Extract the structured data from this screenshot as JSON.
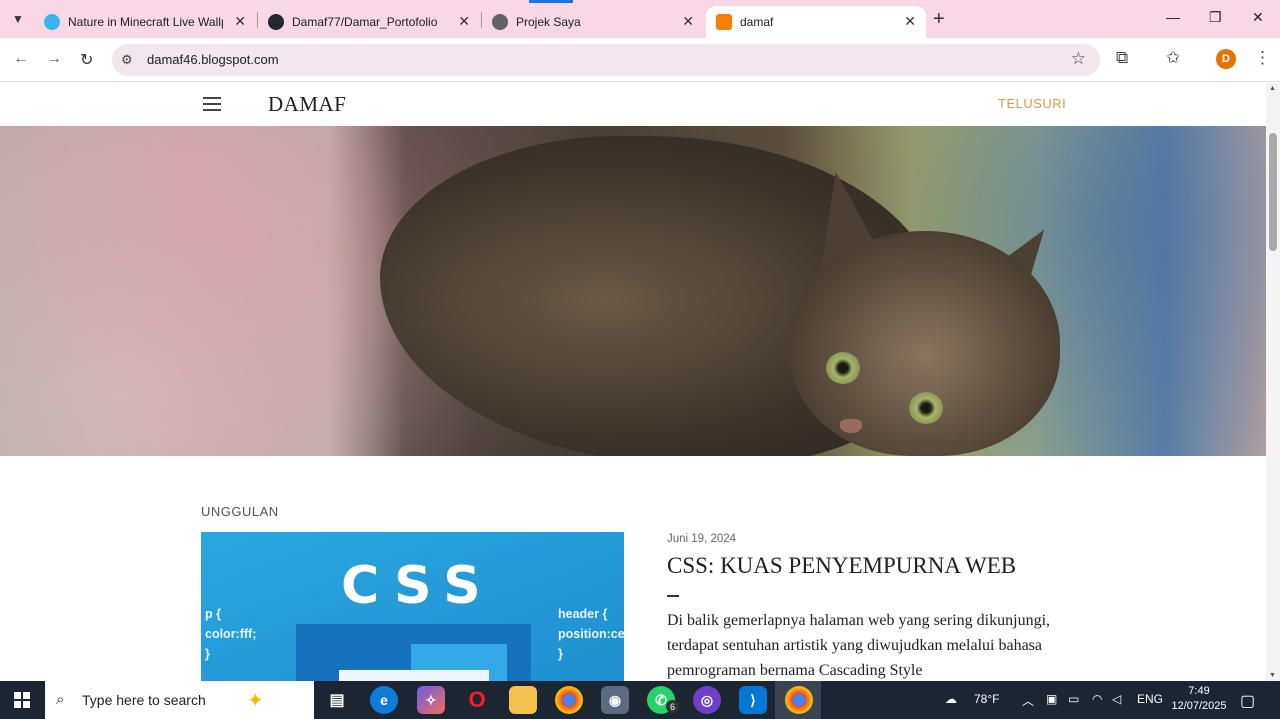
{
  "tabs": [
    {
      "title": "Nature in Minecraft Live Wallpa",
      "favicon": "#3ab5f0"
    },
    {
      "title": "Damaf77/Damar_Portofolio",
      "favicon": "#24292f"
    },
    {
      "title": "Projek Saya",
      "favicon": "#5f6368"
    },
    {
      "title": "damaf",
      "favicon": "#f57d00"
    }
  ],
  "toolbar": {
    "url": "damaf46.blogspot.com",
    "avatar_letter": "D"
  },
  "blog": {
    "title": "DAMAF",
    "search_label": "TELUSURI"
  },
  "featured": {
    "label": "UNGGULAN",
    "thumb_word": "CSS",
    "thumb_code_left": "p {\ncolor:fff;\n}",
    "thumb_code_right": "header {\nposition:cer\n}",
    "date": "Juni 19, 2024",
    "title": "CSS: KUAS PENYEMPURNA WEB",
    "snippet": "Di balik gemerlapnya halaman web yang sering dikunjungi, terdapat sentuhan artistik yang diwujudkan melalui bahasa pemrograman bernama  Cascading Style"
  },
  "taskbar": {
    "search_placeholder": "Type here to search",
    "weather": "78°F",
    "language": "ENG",
    "time": "7:49",
    "date": "12/07/2025",
    "whatsapp_badge": "6"
  }
}
